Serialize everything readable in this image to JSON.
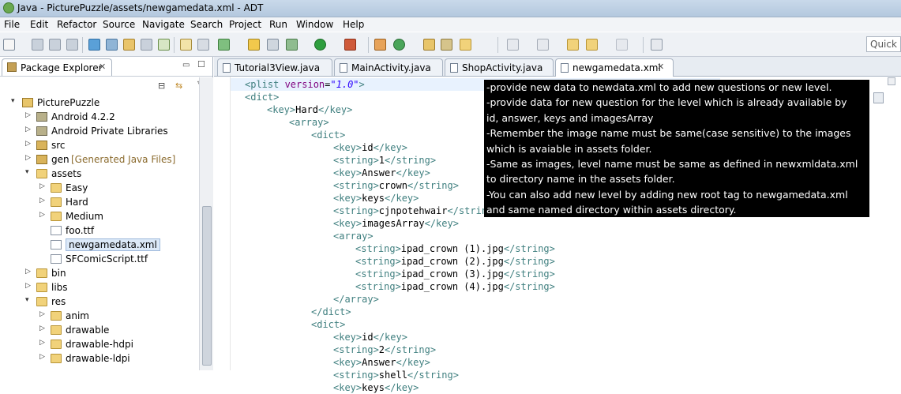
{
  "window": {
    "title": "Java - PicturePuzzle/assets/newgamedata.xml - ADT"
  },
  "menu": [
    "File",
    "Edit",
    "Refactor",
    "Source",
    "Navigate",
    "Search",
    "Project",
    "Run",
    "Window",
    "Help"
  ],
  "quick_access": {
    "placeholder": "Quick Ac"
  },
  "package_explorer": {
    "tab_label": "Package Explorer",
    "tree": [
      {
        "label": "PicturePuzzle",
        "icon": "project-icon",
        "indent": 0,
        "twisty": "▾"
      },
      {
        "label": "Android 4.2.2",
        "icon": "library-icon",
        "indent": 1,
        "twisty": "▷"
      },
      {
        "label": "Android Private Libraries",
        "icon": "library-icon",
        "indent": 1,
        "twisty": "▷"
      },
      {
        "label": "src",
        "icon": "source-folder-icon",
        "indent": 1,
        "twisty": "▷"
      },
      {
        "label": "gen",
        "note": "[Generated Java Files]",
        "icon": "source-folder-icon",
        "indent": 1,
        "twisty": "▷"
      },
      {
        "label": "assets",
        "icon": "folder-icon",
        "indent": 1,
        "twisty": "▾"
      },
      {
        "label": "Easy",
        "icon": "folder-icon",
        "indent": 2,
        "twisty": "▷"
      },
      {
        "label": "Hard",
        "icon": "folder-icon",
        "indent": 2,
        "twisty": "▷"
      },
      {
        "label": "Medium",
        "icon": "folder-icon",
        "indent": 2,
        "twisty": "▷"
      },
      {
        "label": "foo.ttf",
        "icon": "file-icon",
        "indent": 2,
        "twisty": ""
      },
      {
        "label": "newgamedata.xml",
        "icon": "xml-file-icon",
        "indent": 2,
        "twisty": "",
        "selected": true
      },
      {
        "label": "SFComicScript.ttf",
        "icon": "file-icon",
        "indent": 2,
        "twisty": ""
      },
      {
        "label": "bin",
        "icon": "folder-icon",
        "indent": 1,
        "twisty": "▷"
      },
      {
        "label": "libs",
        "icon": "folder-icon",
        "indent": 1,
        "twisty": "▷"
      },
      {
        "label": "res",
        "icon": "folder-icon",
        "indent": 1,
        "twisty": "▾"
      },
      {
        "label": "anim",
        "icon": "folder-icon",
        "indent": 2,
        "twisty": "▷"
      },
      {
        "label": "drawable",
        "icon": "folder-icon",
        "indent": 2,
        "twisty": "▷"
      },
      {
        "label": "drawable-hdpi",
        "icon": "folder-icon",
        "indent": 2,
        "twisty": "▷"
      },
      {
        "label": "drawable-ldpi",
        "icon": "folder-icon",
        "indent": 2,
        "twisty": "▷"
      }
    ]
  },
  "editor": {
    "tabs": [
      {
        "label": "Tutorial3View.java",
        "active": false
      },
      {
        "label": "MainActivity.java",
        "active": false
      },
      {
        "label": "ShopActivity.java",
        "active": false
      },
      {
        "label": "newgamedata.xml",
        "active": true
      }
    ],
    "lines": [
      [
        0,
        [
          [
            "tag",
            "<plist "
          ],
          [
            "attr",
            "version"
          ],
          [
            "txt",
            "="
          ],
          [
            "aval",
            "\"1.0\""
          ],
          [
            "tag",
            ">"
          ]
        ]
      ],
      [
        0,
        [
          [
            "tag",
            "<dict>"
          ]
        ]
      ],
      [
        1,
        [
          [
            "tag",
            "<key>"
          ],
          [
            "txt",
            "Hard"
          ],
          [
            "tag",
            "</key>"
          ]
        ]
      ],
      [
        2,
        [
          [
            "tag",
            "<array>"
          ]
        ]
      ],
      [
        3,
        [
          [
            "tag",
            "<dict>"
          ]
        ]
      ],
      [
        4,
        [
          [
            "tag",
            "<key>"
          ],
          [
            "txt",
            "id"
          ],
          [
            "tag",
            "</key>"
          ]
        ]
      ],
      [
        4,
        [
          [
            "tag",
            "<string>"
          ],
          [
            "txt",
            "1"
          ],
          [
            "tag",
            "</string>"
          ]
        ]
      ],
      [
        4,
        [
          [
            "tag",
            "<key>"
          ],
          [
            "txt",
            "Answer"
          ],
          [
            "tag",
            "</key>"
          ]
        ]
      ],
      [
        4,
        [
          [
            "tag",
            "<string>"
          ],
          [
            "txt",
            "crown"
          ],
          [
            "tag",
            "</string>"
          ]
        ]
      ],
      [
        4,
        [
          [
            "tag",
            "<key>"
          ],
          [
            "txt",
            "keys"
          ],
          [
            "tag",
            "</key>"
          ]
        ]
      ],
      [
        4,
        [
          [
            "tag",
            "<string>"
          ],
          [
            "txt",
            "cjnpotehwair"
          ],
          [
            "tag",
            "</string>"
          ]
        ]
      ],
      [
        4,
        [
          [
            "tag",
            "<key>"
          ],
          [
            "txt",
            "imagesArray"
          ],
          [
            "tag",
            "</key>"
          ]
        ]
      ],
      [
        4,
        [
          [
            "tag",
            "<array>"
          ]
        ]
      ],
      [
        5,
        [
          [
            "tag",
            "<string>"
          ],
          [
            "txt",
            "ipad_crown (1).jpg"
          ],
          [
            "tag",
            "</string>"
          ]
        ]
      ],
      [
        5,
        [
          [
            "tag",
            "<string>"
          ],
          [
            "txt",
            "ipad_crown (2).jpg"
          ],
          [
            "tag",
            "</string>"
          ]
        ]
      ],
      [
        5,
        [
          [
            "tag",
            "<string>"
          ],
          [
            "txt",
            "ipad_crown (3).jpg"
          ],
          [
            "tag",
            "</string>"
          ]
        ]
      ],
      [
        5,
        [
          [
            "tag",
            "<string>"
          ],
          [
            "txt",
            "ipad_crown (4).jpg"
          ],
          [
            "tag",
            "</string>"
          ]
        ]
      ],
      [
        4,
        [
          [
            "tag",
            "</array>"
          ]
        ]
      ],
      [
        3,
        [
          [
            "tag",
            "</dict>"
          ]
        ]
      ],
      [
        3,
        [
          [
            "tag",
            "<dict>"
          ]
        ]
      ],
      [
        4,
        [
          [
            "tag",
            "<key>"
          ],
          [
            "txt",
            "id"
          ],
          [
            "tag",
            "</key>"
          ]
        ]
      ],
      [
        4,
        [
          [
            "tag",
            "<string>"
          ],
          [
            "txt",
            "2"
          ],
          [
            "tag",
            "</string>"
          ]
        ]
      ],
      [
        4,
        [
          [
            "tag",
            "<key>"
          ],
          [
            "txt",
            "Answer"
          ],
          [
            "tag",
            "</key>"
          ]
        ]
      ],
      [
        4,
        [
          [
            "tag",
            "<string>"
          ],
          [
            "txt",
            "shell"
          ],
          [
            "tag",
            "</string>"
          ]
        ]
      ],
      [
        4,
        [
          [
            "tag",
            "<key>"
          ],
          [
            "txt",
            "keys"
          ],
          [
            "tag",
            "</key>"
          ]
        ]
      ]
    ]
  },
  "annotation": {
    "lines": [
      "-provide new data to newdata.xml to add new questions or new level.",
      "-provide data for new question for the level which is already available by",
      "id, answer, keys and imagesArray",
      "-Remember the image name must be same(case sensitive) to the images",
      "which is avaiable in assets folder.",
      "-Same as images, level name must be same as defined in newxmldata.xml",
      "to directory name in the assets folder.",
      "-You can also add new level by adding new root tag to newgamedata.xml",
      "and same named directory within assets directory."
    ]
  },
  "colors": {
    "xml_tag": "#3f7f7f",
    "xml_attr": "#7f007f",
    "xml_value": "#2a00ff",
    "annotation_bg": "#000000",
    "annotation_fg": "#ffffff"
  }
}
